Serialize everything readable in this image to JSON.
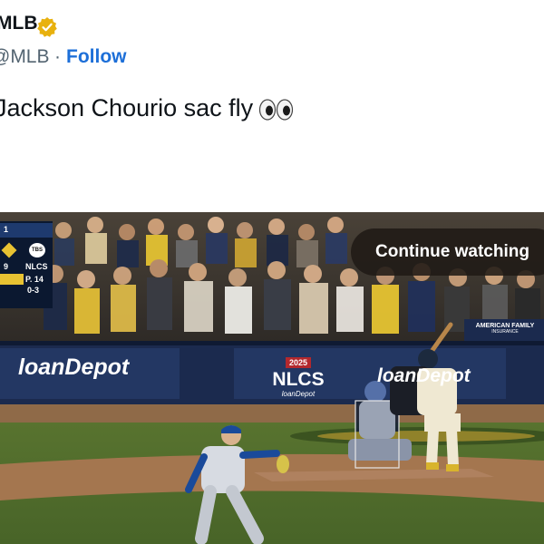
{
  "account": {
    "name": "MLB",
    "handle": "@MLB",
    "separator": "·",
    "follow_label": "Follow"
  },
  "tweet": {
    "text": "Jackson Chourio sac fly",
    "emoji": "eyes-emoji"
  },
  "video": {
    "continue_label": "Continue watching",
    "scorebug": {
      "inning": "1",
      "team_score": "9",
      "series": "NLCS",
      "pitcher_pitches": "P. 14",
      "count": "0-3",
      "network": "TBS"
    },
    "signs": {
      "sponsor_left": "loanDepot",
      "sponsor_right": "loanDepot",
      "year": "2025",
      "series_logo": "NLCS",
      "series_sponsor": "loanDepot",
      "insurance_top": "AMERICAN FAMILY",
      "insurance_bottom": "INSURANCE"
    }
  },
  "colors": {
    "follow": "#1d6fd8",
    "verified": "#e8b10e",
    "wall": "#1b2a4e",
    "grass": "#4f6d2c",
    "dirt": "#a4764f"
  }
}
